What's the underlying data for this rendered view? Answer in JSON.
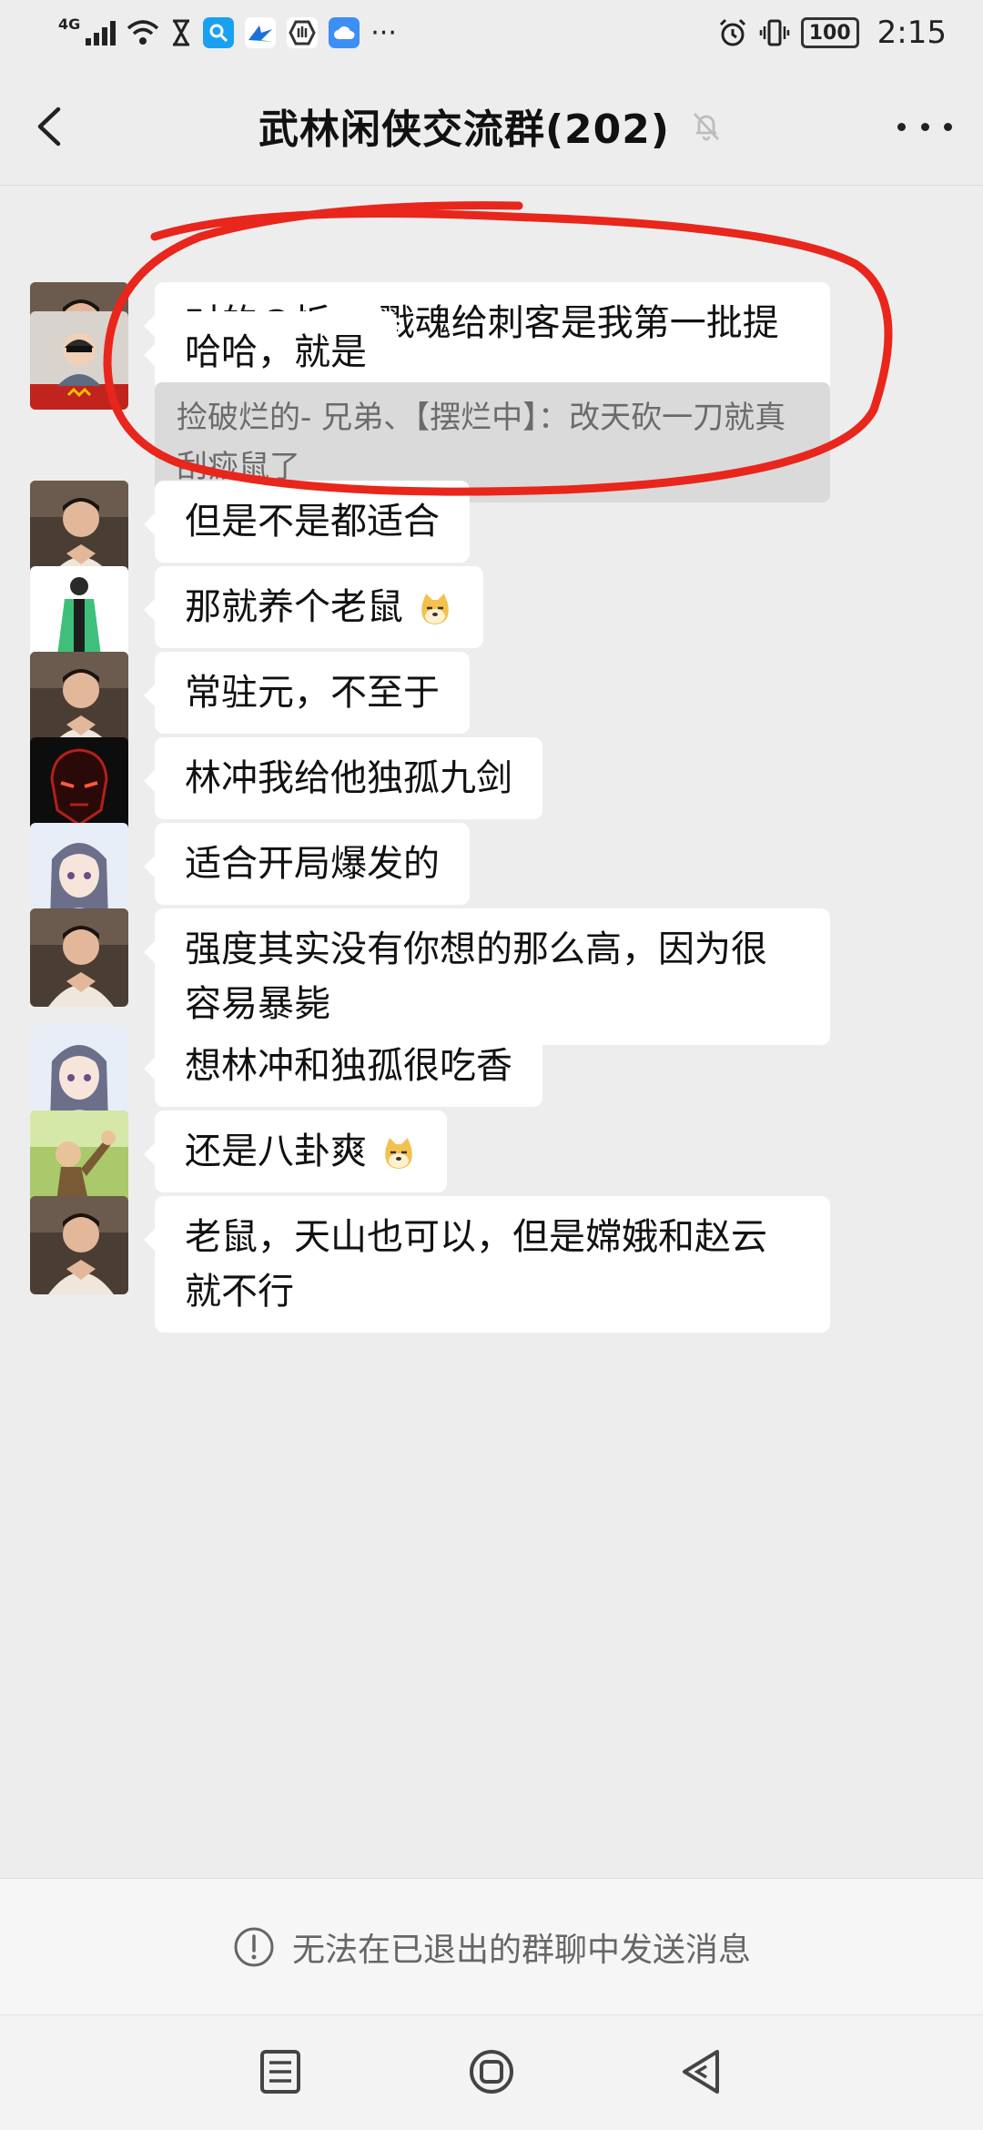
{
  "status_bar": {
    "network": "4G",
    "battery": "100",
    "time": "2:15",
    "more_indicator": "···",
    "icons": [
      "signal-icon",
      "wifi-icon",
      "hourglass-icon",
      "search-app-icon",
      "bird-app-icon",
      "hand-app-icon",
      "cloud-app-icon",
      "alarm-icon",
      "vibrate-icon",
      "battery-icon"
    ]
  },
  "header": {
    "title": "武林闲侠交流群(202)",
    "icons": [
      "back-arrow-icon",
      "muted-bell-icon",
      "more-dots-icon"
    ]
  },
  "messages": [
    {
      "avatar": "man-hands-heart",
      "text": "对的@忻 ，戮魂给刺客是我第一批提出来"
    },
    {
      "avatar": "child-flag",
      "text": "哈哈，就是",
      "quote": "捡破烂的- 兄弟、【摆烂中】：改天砍一刀就真刮痧鼠了"
    },
    {
      "avatar": "man-hands-heart",
      "text": "但是不是都适合"
    },
    {
      "avatar": "person-green-coat",
      "text": "那就养个老鼠"
    },
    {
      "avatar": "man-hands-heart",
      "text": "常驻元，不至于"
    },
    {
      "avatar": "iron-mask",
      "text": "林冲我给他独孤九剑"
    },
    {
      "avatar": "anime-girl",
      "text": "适合开局爆发的"
    },
    {
      "avatar": "man-hands-heart",
      "text": "强度其实没有你想的那么高，因为很容易暴毙"
    },
    {
      "avatar": "anime-girl",
      "text": "想林冲和独孤很吃香"
    },
    {
      "avatar": "cartoon-scene",
      "text": "还是八卦爽"
    },
    {
      "avatar": "man-hands-heart",
      "text": "老鼠，天山也可以，但是嫦娥和赵云就不行"
    }
  ],
  "emoji": "doge-emoji",
  "notice": {
    "text": "无法在已退出的群聊中发送消息",
    "icon": "exclamation-circle-icon"
  },
  "nav_bar": {
    "icons": [
      "menu-icon",
      "home-icon",
      "back-triangle-icon"
    ]
  },
  "colors": {
    "background": "#ededed",
    "bubble": "#ffffff",
    "quote": "#dadada",
    "annotation": "#e8261c"
  }
}
